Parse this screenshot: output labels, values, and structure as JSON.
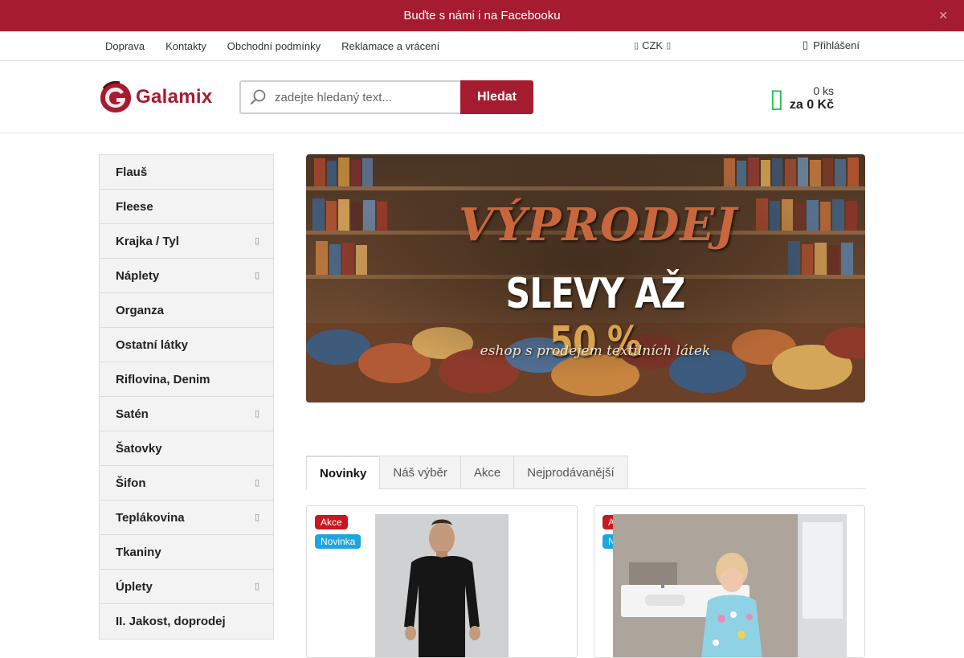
{
  "promo": {
    "text": "Buďte s námi i na Facebooku",
    "close_icon": "close-icon"
  },
  "topnav": {
    "links": [
      "Doprava",
      "Kontakty",
      "Obchodní podmínky",
      "Reklamace a vrácení"
    ],
    "currency": "CZK",
    "login": "Přihlášení"
  },
  "header": {
    "logo_text": "Galamix",
    "search_placeholder": "zadejte hledaný text...",
    "search_button": "Hledat",
    "cart_count": "0 ks",
    "cart_total": "za 0 Kč"
  },
  "categories": [
    {
      "label": "Flauš",
      "has_submenu": false
    },
    {
      "label": "Fleese",
      "has_submenu": false
    },
    {
      "label": "Krajka / Tyl",
      "has_submenu": true
    },
    {
      "label": "Náplety",
      "has_submenu": true
    },
    {
      "label": "Organza",
      "has_submenu": false
    },
    {
      "label": "Ostatní látky",
      "has_submenu": false
    },
    {
      "label": "Riflovina, Denim",
      "has_submenu": false
    },
    {
      "label": "Satén",
      "has_submenu": true
    },
    {
      "label": "Šatovky",
      "has_submenu": false
    },
    {
      "label": "Šifon",
      "has_submenu": true
    },
    {
      "label": "Teplákovina",
      "has_submenu": true
    },
    {
      "label": "Tkaniny",
      "has_submenu": false
    },
    {
      "label": "Úplety",
      "has_submenu": true
    },
    {
      "label": "II. Jakost, doprodej",
      "has_submenu": false
    }
  ],
  "banner": {
    "title": "VÝPRODEJ",
    "subtitle": "SLEVY AŽ",
    "percent": "50 %",
    "tagline": "eshop s prodejem textilních látek"
  },
  "tabs": [
    "Novinky",
    "Náš výběr",
    "Akce",
    "Nejprodávanější"
  ],
  "products": [
    {
      "badge_sale": "Akce",
      "badge_new": "Novinka"
    },
    {
      "badge_sale": "Akce",
      "badge_new": "Novinka"
    }
  ],
  "colors": {
    "brand": "#a51c30",
    "cart": "#1fbb48",
    "sale": "#c81720",
    "new": "#1da5e0"
  }
}
